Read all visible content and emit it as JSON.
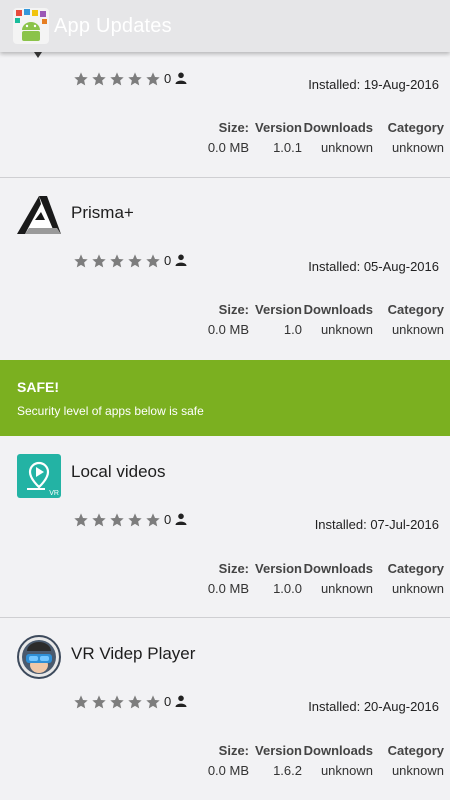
{
  "header": {
    "title": "App Updates",
    "logo_icon": "app-updates-logo-icon"
  },
  "columns": {
    "size": "Size:",
    "version": "Version",
    "downloads": "Downloads",
    "category": "Category"
  },
  "apps": [
    {
      "name": "",
      "icon": "app-icon",
      "rating": 0,
      "rating_count": "0",
      "installed": "Installed: 19-Aug-2016",
      "size": "0.0 MB",
      "version": "1.0.1",
      "downloads": "unknown",
      "category": "unknown"
    },
    {
      "name": "Prisma+",
      "icon": "prisma-logo-icon",
      "rating": 0,
      "rating_count": "0",
      "installed": "Installed: 05-Aug-2016",
      "size": "0.0 MB",
      "version": "1.0",
      "downloads": "unknown",
      "category": "unknown"
    },
    {
      "name": "Local videos",
      "icon": "local-videos-icon",
      "icon_badge": "VR",
      "rating": 0,
      "rating_count": "0",
      "installed": "Installed: 07-Jul-2016",
      "size": "0.0 MB",
      "version": "1.0.0",
      "downloads": "unknown",
      "category": "unknown"
    },
    {
      "name": "VR Videp Player",
      "icon": "vr-headset-avatar-icon",
      "rating": 0,
      "rating_count": "0",
      "installed": "Installed: 20-Aug-2016",
      "size": "0.0 MB",
      "version": "1.6.2",
      "downloads": "unknown",
      "category": "unknown"
    }
  ],
  "safe_banner": {
    "title": "SAFE!",
    "description": "Security level of apps below is safe",
    "color": "#7bb020"
  },
  "colors": {
    "star": "#7d7d7d",
    "separator": "#cfcfd2",
    "local_videos_icon": "#23b3a4"
  }
}
